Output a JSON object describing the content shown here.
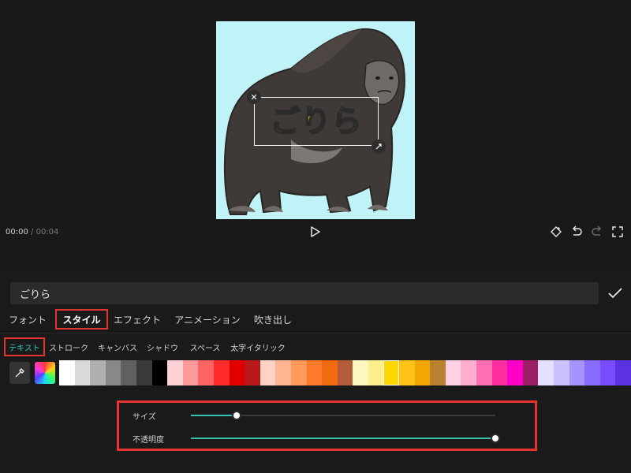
{
  "preview": {
    "overlay_text": "ごりら",
    "time_current": "00:00",
    "time_separator": "/",
    "time_total": "00:04"
  },
  "icons": {
    "close": "close-icon",
    "resize": "resize-icon",
    "play": "play-icon",
    "keyframe": "keyframe-icon",
    "undo": "undo-icon",
    "redo": "redo-icon",
    "fullscreen": "fullscreen-icon",
    "eyedropper": "eyedropper-icon",
    "confirm": "checkmark-icon"
  },
  "text_field": {
    "value": "ごりら"
  },
  "main_tabs": [
    {
      "label": "フォント",
      "active": false
    },
    {
      "label": "スタイル",
      "active": true
    },
    {
      "label": "エフェクト",
      "active": false
    },
    {
      "label": "アニメーション",
      "active": false
    },
    {
      "label": "吹き出し",
      "active": false
    }
  ],
  "sub_tabs": [
    {
      "label": "テキスト",
      "active": true
    },
    {
      "label": "ストローク",
      "active": false
    },
    {
      "label": "キャンバス",
      "active": false
    },
    {
      "label": "シャドウ",
      "active": false
    },
    {
      "label": "スペース",
      "active": false
    },
    {
      "label": "太字イタリック",
      "active": false
    }
  ],
  "palette": {
    "selected_color": "#ffd700",
    "colors": [
      "#ffffff",
      "#d9d9d9",
      "#b0b0b0",
      "#888888",
      "#606060",
      "#3a3a3a",
      "#000000",
      "#ffcfd6",
      "#ff9a9a",
      "#ff6464",
      "#ff2b2b",
      "#e00000",
      "#b81818",
      "#ffd2c4",
      "#ffb58f",
      "#ff9a5a",
      "#ff7a2a",
      "#f26a10",
      "#b45c3a",
      "#fff7c2",
      "#ffef8a",
      "#ffd700",
      "#ffc21a",
      "#f2a600",
      "#b88230",
      "#ffd0e4",
      "#ffadd0",
      "#ff6fb1",
      "#ff2fa0",
      "#ff00c8",
      "#9b1e66",
      "#e4e0ff",
      "#c9c2ff",
      "#a394ff",
      "#8a6bff",
      "#7a4cff",
      "#5a32e0"
    ]
  },
  "sliders": {
    "size": {
      "label": "サイズ",
      "value": 0.15
    },
    "opacity": {
      "label": "不透明度",
      "value": 1.0
    }
  },
  "colors": {
    "accent": "#32c6b6",
    "highlight": "#e3342f",
    "text_yellow": "#ffd70a",
    "canvas_bg": "#bff3f8"
  }
}
